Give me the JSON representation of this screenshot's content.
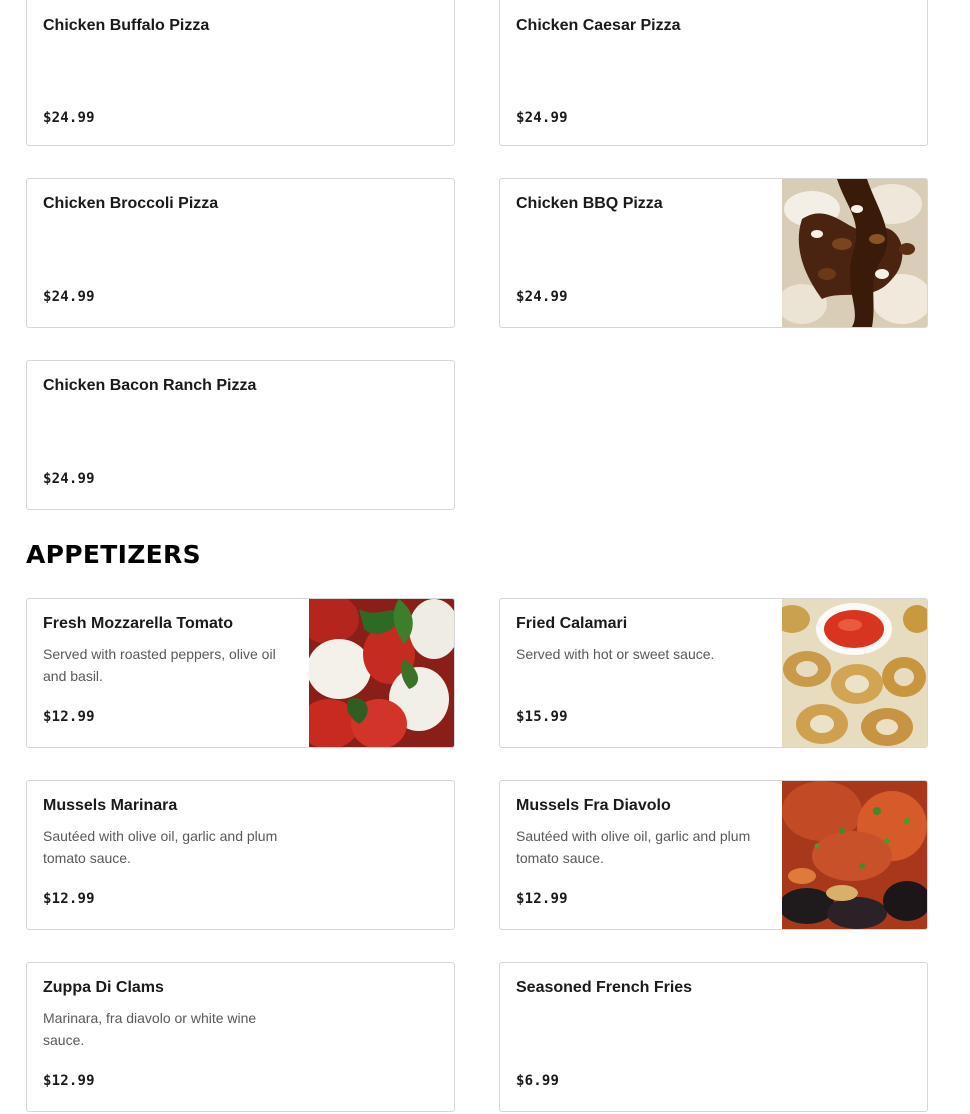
{
  "pizzas": [
    {
      "name": "Chicken Buffalo Pizza",
      "price": "$24.99"
    },
    {
      "name": "Chicken Caesar Pizza",
      "price": "$24.99"
    },
    {
      "name": "Chicken Broccoli Pizza",
      "price": "$24.99"
    },
    {
      "name": "Chicken BBQ Pizza",
      "price": "$24.99",
      "image": "bbq-pizza-photo"
    },
    {
      "name": "Chicken Bacon Ranch Pizza",
      "price": "$24.99"
    }
  ],
  "appetizers": {
    "title": "APPETIZERS",
    "items": [
      {
        "name": "Fresh Mozzarella Tomato",
        "description": "Served with roasted peppers, olive oil and basil.",
        "price": "$12.99",
        "image": "mozzarella-tomato-photo"
      },
      {
        "name": "Fried Calamari",
        "description": "Served with hot or sweet sauce.",
        "price": "$15.99",
        "image": "fried-calamari-photo"
      },
      {
        "name": "Mussels Marinara",
        "description": "Sautéed with olive oil, garlic and plum tomato sauce.",
        "price": "$12.99"
      },
      {
        "name": "Mussels Fra Diavolo",
        "description": "Sautéed with olive oil, garlic and plum tomato sauce.",
        "price": "$12.99",
        "image": "mussels-fra-diavolo-photo"
      },
      {
        "name": "Zuppa Di Clams",
        "description": "Marinara, fra diavolo or white wine sauce.",
        "price": "$12.99"
      },
      {
        "name": "Seasoned French Fries",
        "price": "$6.99"
      }
    ]
  },
  "colors": {
    "card_border": "#d6d6d6",
    "text": "#1a1a1a",
    "description": "#595959"
  }
}
